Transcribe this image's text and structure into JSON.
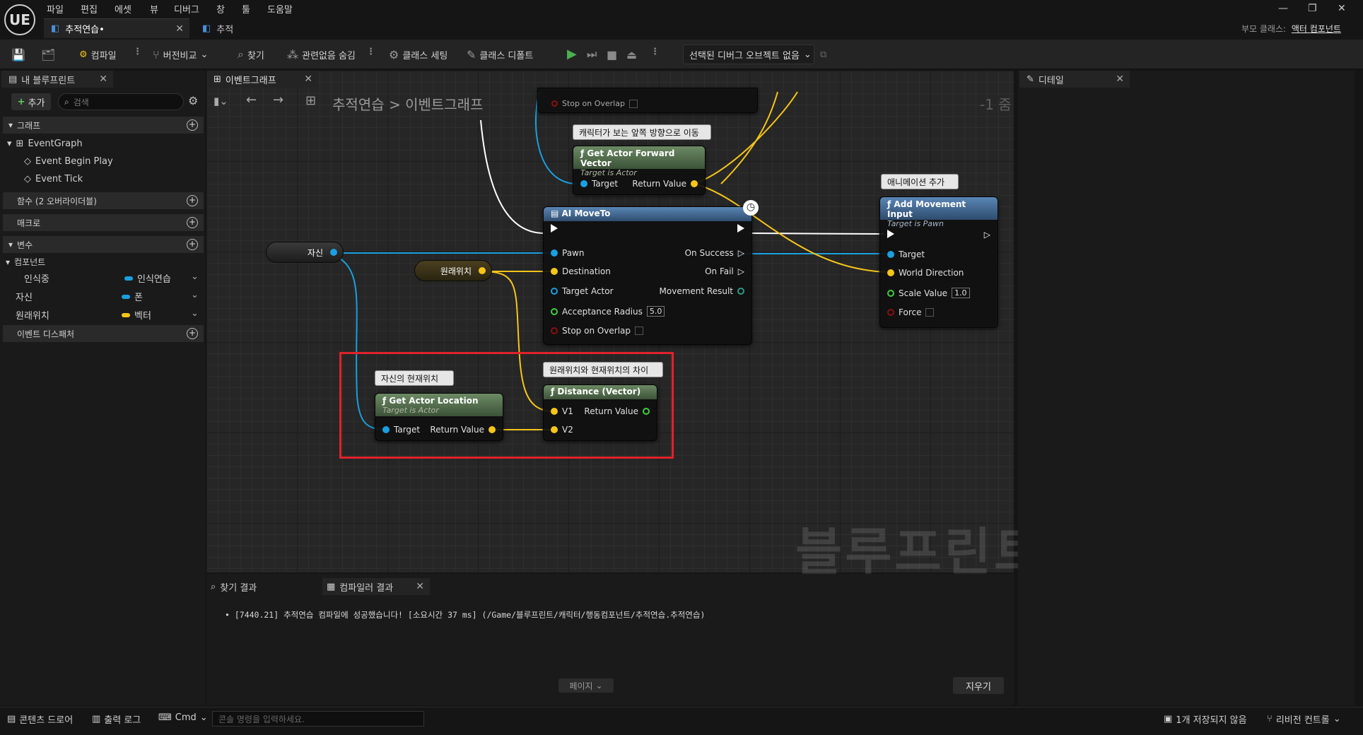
{
  "app": {
    "logo": "UE"
  },
  "menu": [
    "파일",
    "편집",
    "에셋",
    "뷰",
    "디버그",
    "창",
    "툴",
    "도움말"
  ],
  "doc_tabs": [
    {
      "label": "추적연습•"
    },
    {
      "label": "추적"
    }
  ],
  "parent_class": {
    "label": "부모 클래스:",
    "value": "액터 컴포넌트"
  },
  "toolbar": {
    "compile": "컴파일",
    "diff": "버전비교",
    "find": "찾기",
    "hide_unrelated": "관련없음 숨김",
    "class_settings": "클래스 세팅",
    "class_defaults": "클래스 디폴트",
    "debug_object": "선택된 디버그 오브젝트 없음"
  },
  "left_panel": {
    "tab": "내 블루프린트",
    "add": "추가",
    "search_placeholder": "검색",
    "graph_header": "그래프",
    "event_graph": "EventGraph",
    "events": [
      "Event Begin Play",
      "Event Tick"
    ],
    "functions_header": "함수 (2 오버라이더블)",
    "macros_header": "매크로",
    "variables_header": "변수",
    "components_label": "컴포넌트",
    "variables": [
      {
        "name": "인식중",
        "type": "인식연습",
        "color": "#1a9fe0"
      },
      {
        "name": "자신",
        "type": "폰",
        "color": "#1a9fe0"
      },
      {
        "name": "원래위치",
        "type": "벡터",
        "color": "#f5c518"
      }
    ],
    "dispatchers_header": "이벤트 디스패처"
  },
  "graph": {
    "tab": "이벤트그래프",
    "breadcrumb": "추적연습 > 이벤트그래프",
    "zoom": "-1 줌",
    "watermark": "블루프린트",
    "comments": {
      "forward": "캐릭터가 보는 앞쪽 방향으로 이동",
      "anim": "애니메이션 추가",
      "self_loc": "자신의 현재위치",
      "diff": "원래위치와 현재위치의 차이"
    },
    "getters": {
      "self": "자신",
      "origin": "원래위치"
    },
    "top_partial": {
      "stop_on_overlap": "Stop on Overlap"
    },
    "forward_node": {
      "title": "Get Actor Forward Vector",
      "sub": "Target is Actor",
      "target": "Target",
      "ret": "Return Value"
    },
    "moveto_node": {
      "title": "AI MoveTo",
      "pawn": "Pawn",
      "destination": "Destination",
      "target_actor": "Target Actor",
      "acceptance": "Acceptance Radius",
      "acceptance_val": "5.0",
      "stop": "Stop on Overlap",
      "on_success": "On Success",
      "on_fail": "On Fail",
      "movement_result": "Movement Result"
    },
    "addmove_node": {
      "title": "Add Movement Input",
      "sub": "Target is Pawn",
      "target": "Target",
      "world_dir": "World Direction",
      "scale": "Scale Value",
      "scale_val": "1.0",
      "force": "Force"
    },
    "location_node": {
      "title": "Get Actor Location",
      "sub": "Target is Actor",
      "target": "Target",
      "ret": "Return Value"
    },
    "distance_node": {
      "title": "Distance (Vector)",
      "v1": "V1",
      "v2": "V2",
      "ret": "Return Value"
    }
  },
  "bottom_panel": {
    "find_tab": "찾기 결과",
    "compiler_tab": "컴파일러 결과",
    "log": "• [7440.21] 추적연습 컴파일에 성공했습니다! [소요시간 37 ms] (/Game/블루프린트/캐릭터/행동컴포넌트/추적연습.추적연습)",
    "page": "페이지",
    "clear": "지우기"
  },
  "details": {
    "tab": "디테일"
  },
  "statusbar": {
    "content_drawer": "콘텐츠 드로어",
    "output_log": "출력 로그",
    "cmd": "Cmd",
    "console_placeholder": "콘솔 명령을 입력하세요.",
    "unsaved": "1개 저장되지 않음",
    "revision": "리비전 컨트롤"
  },
  "colors": {
    "object_pin": "#1a9fe0",
    "vector_pin": "#f5c518",
    "float_pin": "#3fcf3f",
    "bool_pin": "#8a1010",
    "highlight": "#e0222a"
  }
}
